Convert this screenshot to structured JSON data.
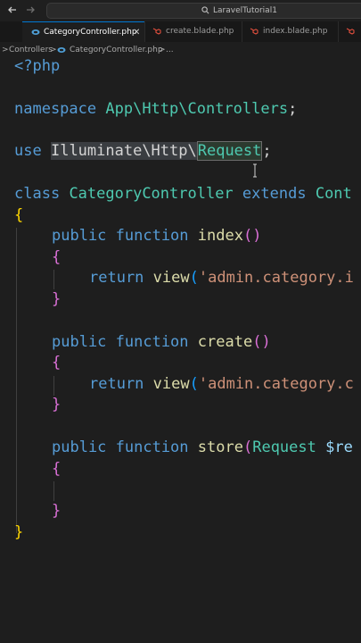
{
  "titlebar": {
    "back_icon": "arrow-left-icon",
    "forward_icon": "arrow-right-icon",
    "search_text": "LaravelTutorial1"
  },
  "tabs": [
    {
      "label": "CategoryController.php",
      "icon": "php-elephant-icon",
      "active": true,
      "close": "✕"
    },
    {
      "label": "create.blade.php",
      "icon": "laravel-blade-icon",
      "active": false
    },
    {
      "label": "index.blade.php",
      "icon": "laravel-blade-icon",
      "active": false
    },
    {
      "label": "",
      "icon": "laravel-blade-icon",
      "active": false
    }
  ],
  "breadcrumb": {
    "sep1": ">",
    "folder": "Controllers",
    "sep2": ">",
    "file": "CategoryController.php",
    "sep3": ">",
    "more": "..."
  },
  "code": {
    "l1": "<?php",
    "l2_kw": "namespace",
    "l2_ns": "App\\Http\\Controllers",
    "l2_end": ";",
    "l3_kw": "use",
    "l3_ns": "Illuminate\\Http\\",
    "l3_cls": "Request",
    "l3_end": ";",
    "l4_kw1": "class",
    "l4_name": "CategoryController",
    "l4_kw2": "extends",
    "l4_parent": "Cont",
    "brace_open": "{",
    "brace_close": "}",
    "m1_kw": "public function",
    "m1_name": "index",
    "m1_params": "()",
    "m1_return": "return",
    "m1_view": "view",
    "m1_paren": "(",
    "m1_str": "'admin.category.i",
    "m2_kw": "public function",
    "m2_name": "create",
    "m2_params": "()",
    "m2_return": "return",
    "m2_view": "view",
    "m2_paren": "(",
    "m2_str": "'admin.category.c",
    "m3_kw": "public function",
    "m3_name": "store",
    "m3_paren": "(",
    "m3_type": "Request",
    "m3_var": "$re"
  },
  "colors": {
    "editor_bg": "#1e1e1e",
    "keyword": "#569cd6",
    "type": "#4ec9b0",
    "function": "#dcdcaa",
    "string": "#ce9178",
    "variable": "#9cdcfe",
    "tab_accent": "#0078d4"
  }
}
